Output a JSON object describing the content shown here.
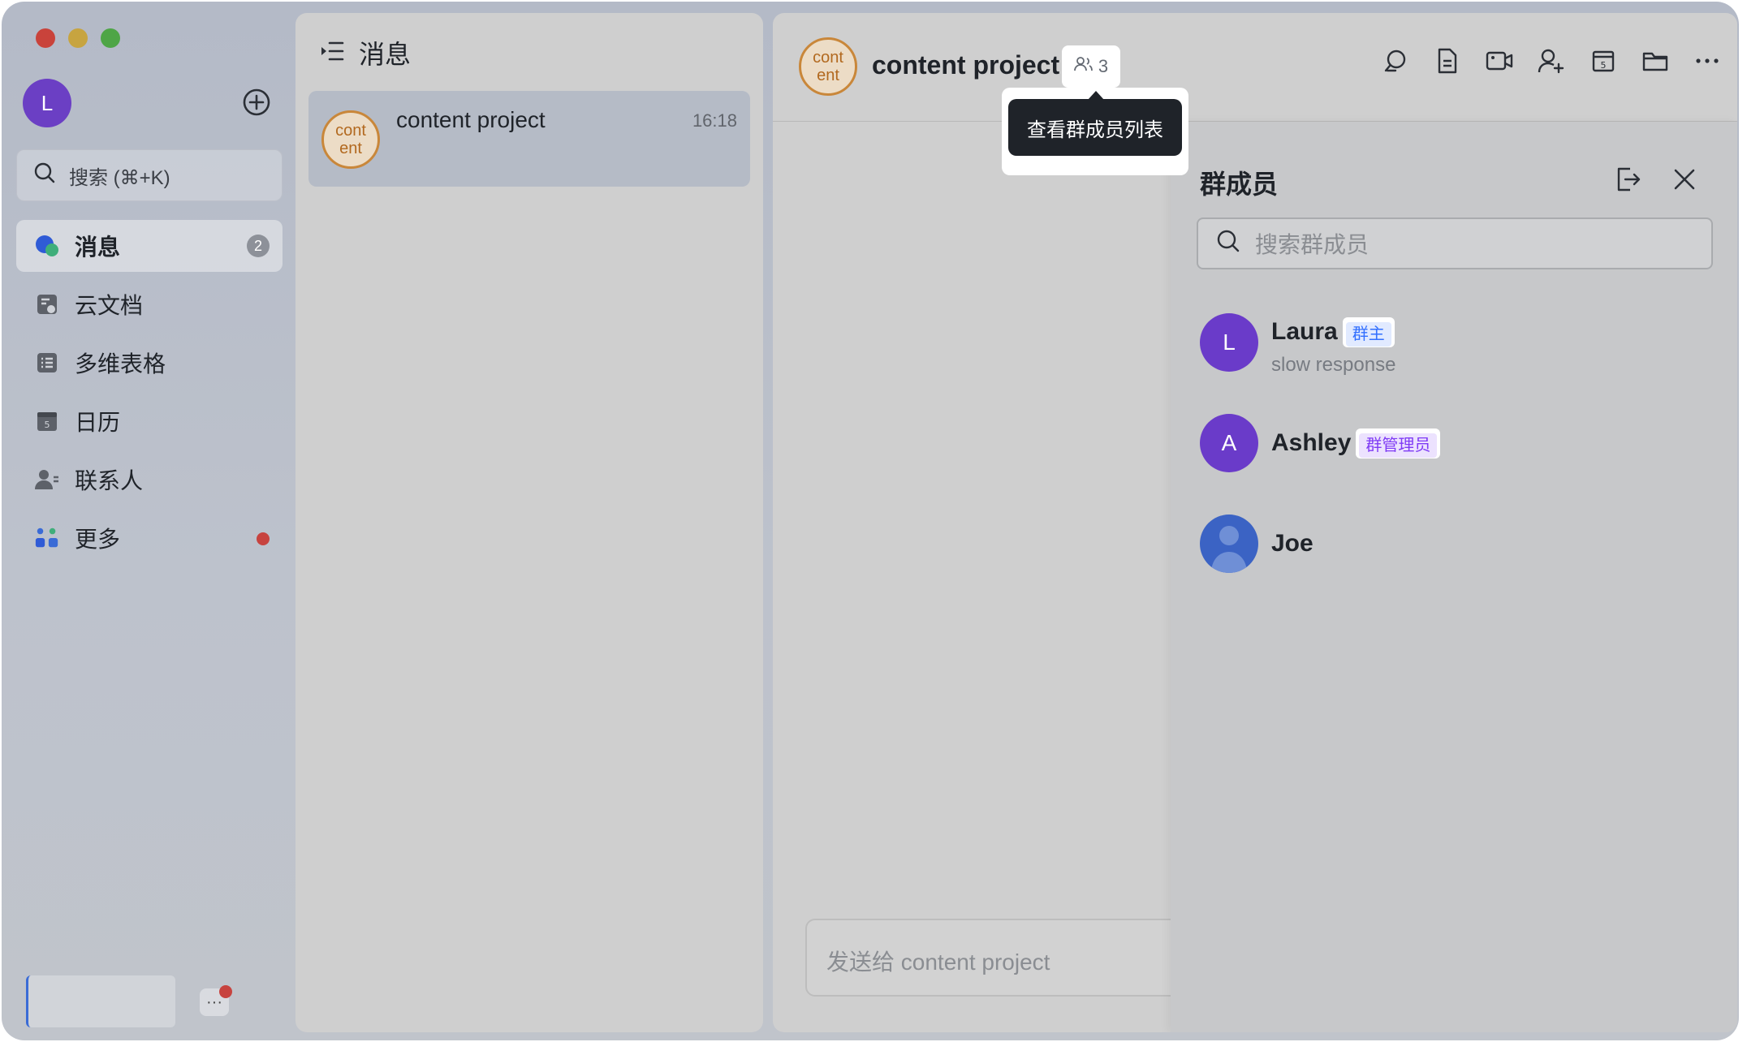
{
  "window": {
    "traffic_lights": {
      "red": "#c9433b",
      "yellow": "#c7a440",
      "green": "#4ea546"
    }
  },
  "sidebar": {
    "user_avatar_initial": "L",
    "user_avatar_color": "#6b3fc4",
    "search_placeholder": "搜索 (⌘+K)",
    "items": [
      {
        "label": "消息",
        "icon": "message-icon",
        "active": true,
        "badge": "2"
      },
      {
        "label": "云文档",
        "icon": "cloud-docs-icon",
        "active": false
      },
      {
        "label": "多维表格",
        "icon": "base-table-icon",
        "active": false
      },
      {
        "label": "日历",
        "icon": "calendar-icon",
        "active": false
      },
      {
        "label": "联系人",
        "icon": "contacts-icon",
        "active": false
      },
      {
        "label": "更多",
        "icon": "more-apps-icon",
        "active": false,
        "dot": true
      }
    ],
    "more_bubble": "···"
  },
  "conversation_list": {
    "title": "消息",
    "items": [
      {
        "avatar_text_line1": "cont",
        "avatar_text_line2": "ent",
        "name": "content project",
        "time": "16:18"
      }
    ]
  },
  "chat": {
    "avatar_text_line1": "cont",
    "avatar_text_line2": "ent",
    "title": "content project",
    "member_count": "3",
    "tooltip": "查看群成员列表",
    "toolbar": [
      "search-icon",
      "doc-icon",
      "video-call-icon",
      "add-member-icon",
      "calendar-icon",
      "folder-icon",
      "more-icon"
    ],
    "composer_placeholder": "发送给 content project"
  },
  "members_drawer": {
    "title": "群成员",
    "search_placeholder": "搜索群成员",
    "members": [
      {
        "initial": "L",
        "name": "Laura",
        "tag": "群主",
        "tag_color": "#3370ff",
        "tag_bg": "#e1eaff",
        "status": "slow response",
        "avatar_color": "#6a3bc9"
      },
      {
        "initial": "A",
        "name": "Ashley",
        "tag": "群管理员",
        "tag_color": "#7f3bf5",
        "tag_bg": "#ece2fe",
        "status": "",
        "avatar_color": "#6a3bc9"
      },
      {
        "initial": "",
        "name": "Joe",
        "tag": "",
        "status": "",
        "avatar_color": "#3b63c4"
      }
    ]
  }
}
